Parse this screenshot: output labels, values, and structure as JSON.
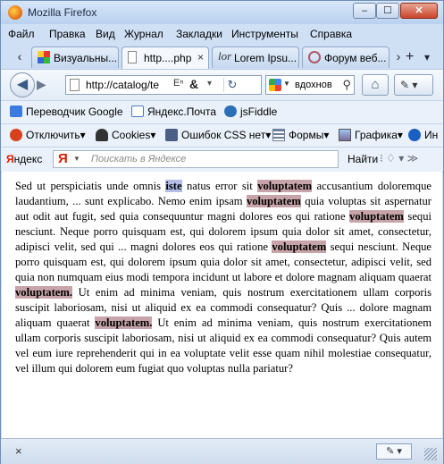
{
  "window": {
    "title": "Mozilla Firefox",
    "min": "–",
    "max": "☐",
    "close": "✕"
  },
  "menu": [
    "Файл",
    "Правка",
    "Вид",
    "Журнал",
    "Закладки",
    "Инструменты",
    "Справка"
  ],
  "tabs": [
    {
      "label": "Визуальны...",
      "icon": "grid-icon",
      "active": false
    },
    {
      "label": "http....php",
      "icon": "page-icon",
      "active": true
    },
    {
      "label": "Lorem Ipsu...",
      "icon": "lorem-icon",
      "active": false
    },
    {
      "label": "Форум веб...",
      "icon": "forum-icon",
      "active": false
    }
  ],
  "tab_controls": {
    "scroll_left": "‹",
    "scroll_right": "›",
    "new_tab": "+",
    "list": "▾",
    "close": "×"
  },
  "nav": {
    "back": "◀",
    "forward": "▶",
    "url": "http://catalog/te",
    "ext_translate": "Eⁿ",
    "ext_amp": "&",
    "ext_arrow": "▾",
    "reload": "↻",
    "search_value": "вдохнов",
    "search_engine_dd": "▼",
    "search_mag": "⚲",
    "home": "⌂",
    "addon": "✎ ▾"
  },
  "bookmarks": [
    {
      "label": "Переводчик Google",
      "color": "#3a7be0"
    },
    {
      "label": "Яндекс.Почта",
      "color": "#4a78c2"
    },
    {
      "label": "jsFiddle",
      "color": "#2a6fb8"
    }
  ],
  "devtools": [
    {
      "label": "Отключить▾",
      "color": "#d9401c"
    },
    {
      "label": "Cookies▾",
      "color": "#333333"
    },
    {
      "label": "Ошибок CSS нет▾",
      "color": "#4b5f86"
    },
    {
      "label": "Формы▾",
      "color": "#6d7f99"
    },
    {
      "label": "Графика▾",
      "color": "#7a6a9c"
    },
    {
      "label": "Ин",
      "color": "#1b5fc2"
    }
  ],
  "yandex": {
    "logo_rest": "ндекс",
    "logo_first": "Я",
    "search_y": "Я",
    "search_dd": "▼",
    "placeholder": "Поискать в Яндексе",
    "find": "Найти",
    "more": "⁝ ♢ ▾ ≫"
  },
  "content": {
    "segments": [
      {
        "t": "Sed ut perspiciatis unde omnis ",
        "h": ""
      },
      {
        "t": "iste",
        "h": "blue"
      },
      {
        "t": " natus error sit ",
        "h": ""
      },
      {
        "t": "voluptatem",
        "h": "red"
      },
      {
        "t": " accusantium doloremque laudantium, ... sunt explicabo. Nemo enim ipsam ",
        "h": ""
      },
      {
        "t": "voluptatem",
        "h": "red"
      },
      {
        "t": " quia voluptas sit aspernatur aut odit aut fugit, sed quia consequuntur magni dolores eos qui ratione ",
        "h": ""
      },
      {
        "t": "voluptatem",
        "h": "red"
      },
      {
        "t": " sequi nesciunt. Neque porro quisquam est, qui dolorem ipsum quia dolor sit amet, consectetur, adipisci velit, sed qui ... magni dolores eos qui ratione ",
        "h": ""
      },
      {
        "t": "voluptatem",
        "h": "red"
      },
      {
        "t": " sequi nesciunt. Neque porro quisquam est, qui dolorem ipsum quia dolor sit amet, consectetur, adipisci velit, sed quia non numquam eius modi tempora incidunt ut labore et dolore magnam aliquam quaerat ",
        "h": ""
      },
      {
        "t": "voluptatem.",
        "h": "red"
      },
      {
        "t": " Ut enim ad minima veniam, quis nostrum exercitationem ullam corporis suscipit laboriosam, nisi ut aliquid ex ea commodi consequatur? Quis ... dolore magnam aliquam quaerat ",
        "h": ""
      },
      {
        "t": "voluptatem.",
        "h": "red"
      },
      {
        "t": " Ut enim ad minima veniam, quis nostrum exercitationem ullam corporis suscipit laboriosam, nisi ut aliquid ex ea commodi consequatur? Quis autem vel eum iure reprehenderit qui in ea voluptate velit esse quam nihil molestiae consequatur, vel illum qui dolorem eum fugiat quo voluptas nulla pariatur?",
        "h": ""
      }
    ]
  },
  "status": {
    "close": "×",
    "tool": "✎ ▾"
  },
  "colors": {
    "highlight_red": "#c7a4a9",
    "highlight_blue": "#b3bde6",
    "chrome": "#cfe0f5"
  }
}
